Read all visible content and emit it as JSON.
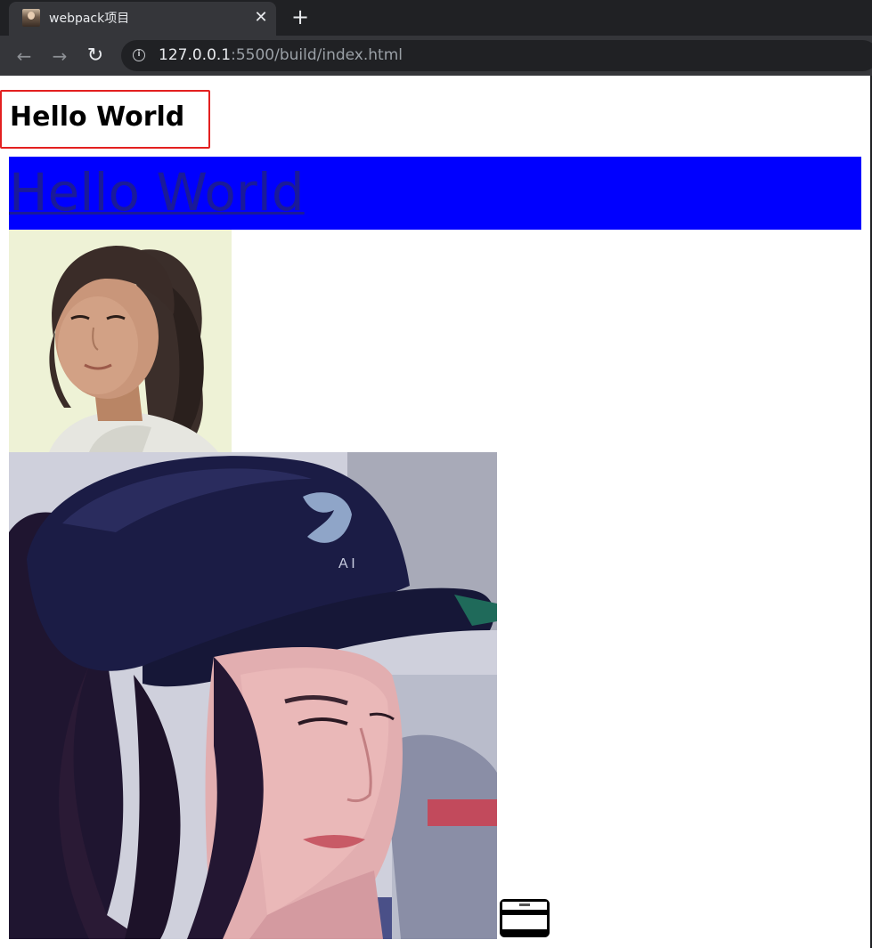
{
  "browser": {
    "tab_title": "webpack项目",
    "url_host": "127.0.0.1",
    "url_rest": ":5500/build/index.html"
  },
  "page": {
    "heading": "Hello World",
    "link_text": "Hello World"
  },
  "colors": {
    "banner": "#0000ff",
    "link": "#1a1a99",
    "highlight_border": "#e32020",
    "chrome_dark": "#202124",
    "chrome_tab": "#35363a"
  }
}
